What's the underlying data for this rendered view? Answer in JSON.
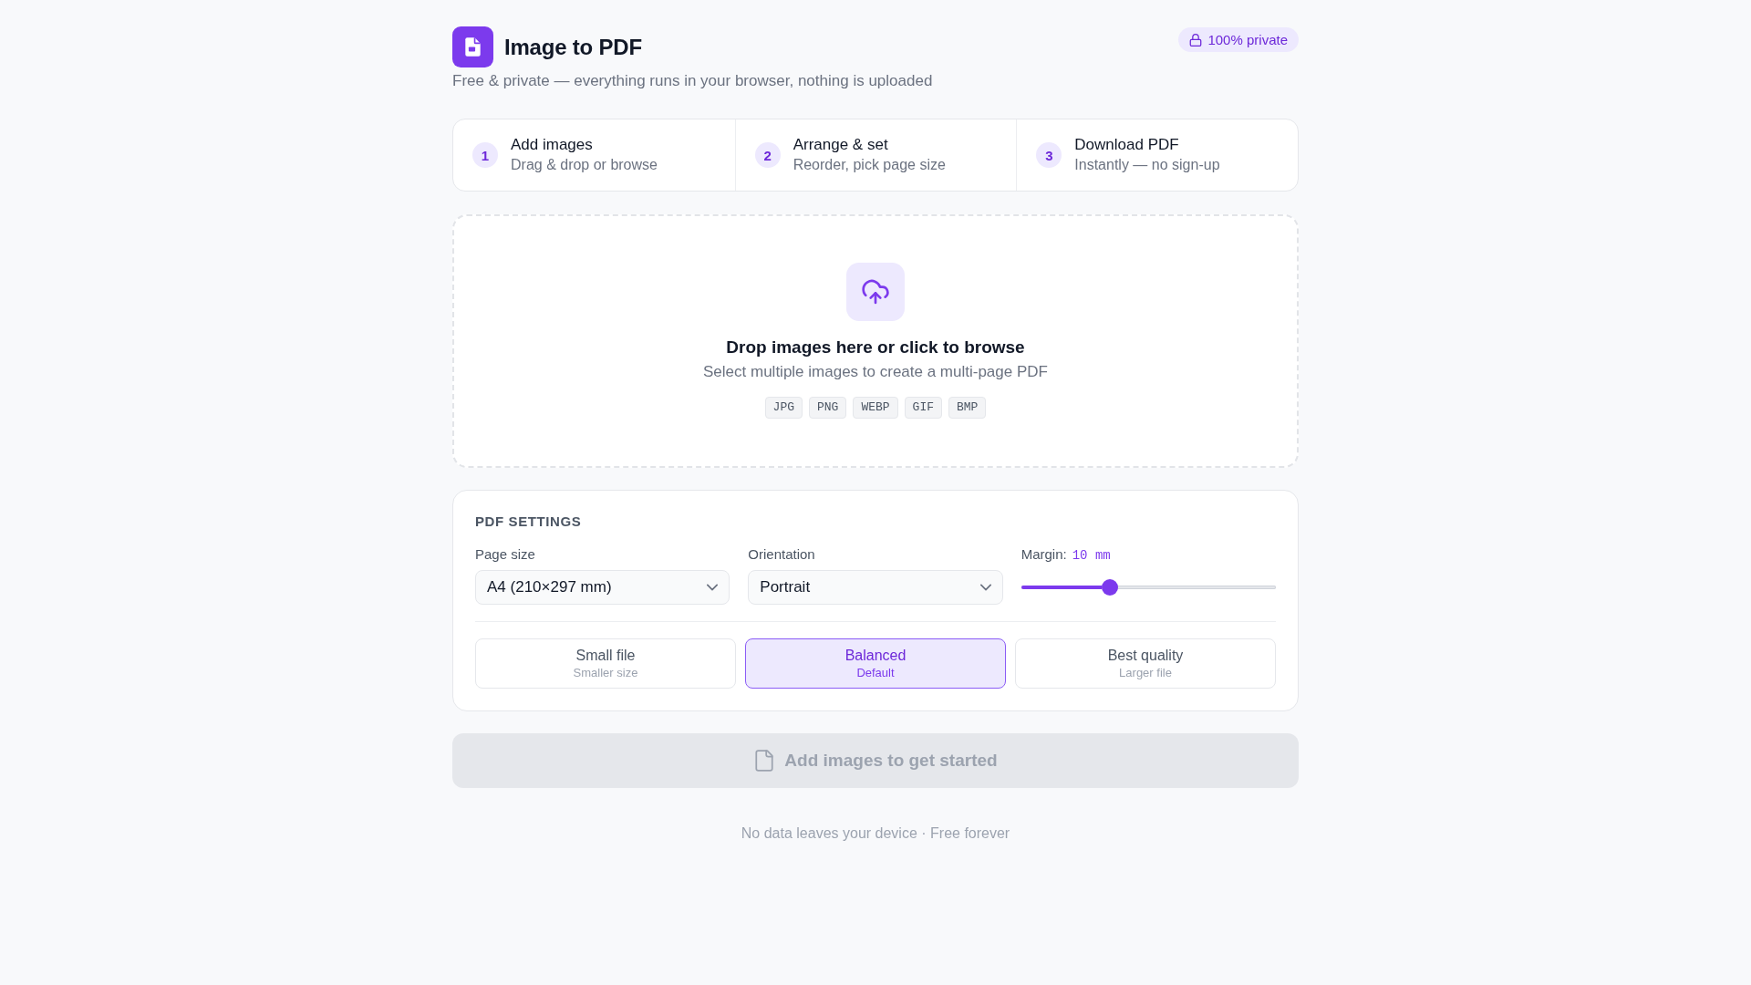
{
  "header": {
    "title": "Image to PDF",
    "subtitle": "Free & private — everything runs in your browser, nothing is uploaded",
    "badge": "100% private"
  },
  "steps": [
    {
      "number": "1",
      "title": "Add images",
      "description": "Drag & drop or browse"
    },
    {
      "number": "2",
      "title": "Arrange & set",
      "description": "Reorder, pick page size"
    },
    {
      "number": "3",
      "title": "Download PDF",
      "description": "Instantly — no sign-up"
    }
  ],
  "dropzone": {
    "title": "Drop images here or click to browse",
    "subtitle": "Select multiple images to create a multi-page PDF",
    "formats": [
      "JPG",
      "PNG",
      "WEBP",
      "GIF",
      "BMP"
    ]
  },
  "settings": {
    "title": "PDF SETTINGS",
    "page_size": {
      "label": "Page size",
      "value": "A4 (210×297 mm)"
    },
    "orientation": {
      "label": "Orientation",
      "value": "Portrait"
    },
    "margin": {
      "label": "Margin:",
      "reading": "10 mm",
      "level": 0.35
    },
    "quality_options": [
      {
        "label": "Small file",
        "description": "Smaller size",
        "selected": false
      },
      {
        "label": "Balanced",
        "description": "Default",
        "selected": true
      },
      {
        "label": "Best quality",
        "description": "Larger file",
        "selected": false
      }
    ]
  },
  "action_button": {
    "label": "Add images to get started",
    "disabled": true
  },
  "footer": "No data leaves your device · Free forever"
}
